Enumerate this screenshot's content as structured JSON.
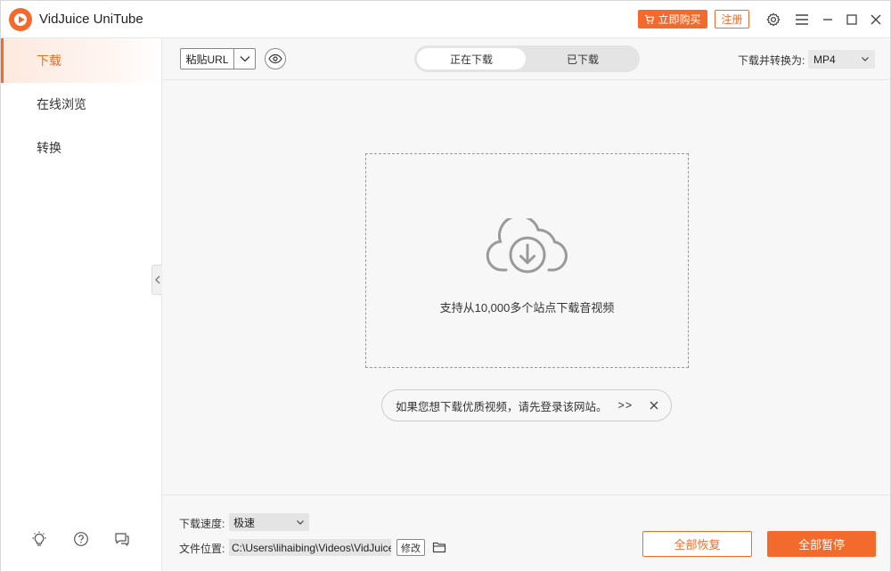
{
  "app": {
    "title": "VidJuice UniTube",
    "buy_label": "立即购买",
    "register_label": "注册"
  },
  "sidebar": {
    "items": [
      {
        "label": "下载",
        "active": true
      },
      {
        "label": "在线浏览",
        "active": false
      },
      {
        "label": "转换",
        "active": false
      }
    ],
    "bottom_icons": [
      "lightbulb-icon",
      "help-icon",
      "feedback-icon"
    ]
  },
  "toolbar": {
    "paste_label": "粘贴URL",
    "tabs": [
      {
        "label": "正在下载",
        "active": true
      },
      {
        "label": "已下载",
        "active": false
      }
    ],
    "convert_label": "下载并转换为:",
    "convert_format": "MP4"
  },
  "main": {
    "drop_text": "支持从10,000多个站点下载音视频",
    "tip_text": "如果您想下载优质视频，请先登录该网站。",
    "tip_more": ">>"
  },
  "footer": {
    "speed_label": "下载速度:",
    "speed_value": "极速",
    "location_label": "文件位置:",
    "location_value": "C:\\Users\\lihaibing\\Videos\\VidJuice",
    "modify_label": "修改",
    "resume_all_label": "全部恢复",
    "pause_all_label": "全部暂停"
  },
  "colors": {
    "accent": "#f36b2c",
    "background": "#f7f7f7",
    "sidebar": "#ffffff"
  }
}
